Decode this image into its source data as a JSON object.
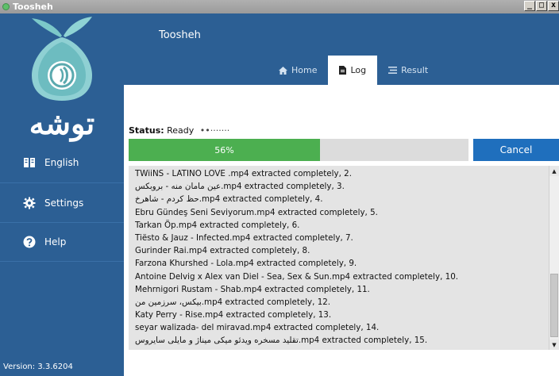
{
  "window": {
    "title": "Toosheh",
    "controls": [
      "_",
      "□",
      "x"
    ]
  },
  "sidebar": {
    "logo_text": "توشه",
    "items": [
      {
        "label": "English",
        "icon": "language-book-icon"
      },
      {
        "label": "Settings",
        "icon": "gear-icon"
      },
      {
        "label": "Help",
        "icon": "question-circle-icon"
      }
    ],
    "version": "Version: 3.3.6204"
  },
  "header": {
    "title": "Toosheh",
    "tabs": [
      {
        "label": "Home",
        "icon": "home-icon",
        "active": false
      },
      {
        "label": "Log",
        "icon": "file-icon",
        "active": true
      },
      {
        "label": "Result",
        "icon": "list-icon",
        "active": false
      }
    ]
  },
  "status": {
    "label": "Status:",
    "value": "Ready",
    "dots": "••·······"
  },
  "progress": {
    "text": "56%",
    "fraction": 0.56,
    "color": "#4caf50"
  },
  "cancel_label": "Cancel",
  "log_lines": [
    "TWiiNS - LATINO LOVE .mp4 extracted completely, 2.",
    "عین مامان منه - بروبکس.mp4 extracted completely, 3.",
    "حظ کردم - شاهرخ.mp4 extracted completely, 4.",
    "Ebru Gündeş Seni Seviyorum.mp4 extracted completely, 5.",
    "Tarkan Öp.mp4 extracted completely, 6.",
    "Tiësto & Jauz - Infected.mp4 extracted completely, 7.",
    "Gurinder Rai.mp4 extracted completely, 8.",
    "Farzona Khurshed - Lola.mp4 extracted completely, 9.",
    "Antoine Delvig x Alex van Diel - Sea, Sex & Sun.mp4 extracted completely, 10.",
    "Mehrnigori Rustam - Shab.mp4 extracted completely, 11.",
    "بیکس، سرزمین من.mp4 extracted completely, 12.",
    "Katy Perry - Rise.mp4 extracted completely, 13.",
    "seyar walizada- del miravad.mp4 extracted completely, 14.",
    "تقلید مسخره ویدئو میکی میناژ و مایلی سایروس.mp4 extracted completely, 15."
  ],
  "colors": {
    "brand_blue": "#2c5f94",
    "cancel_blue": "#1f6fbd",
    "progress_green": "#4caf50"
  }
}
